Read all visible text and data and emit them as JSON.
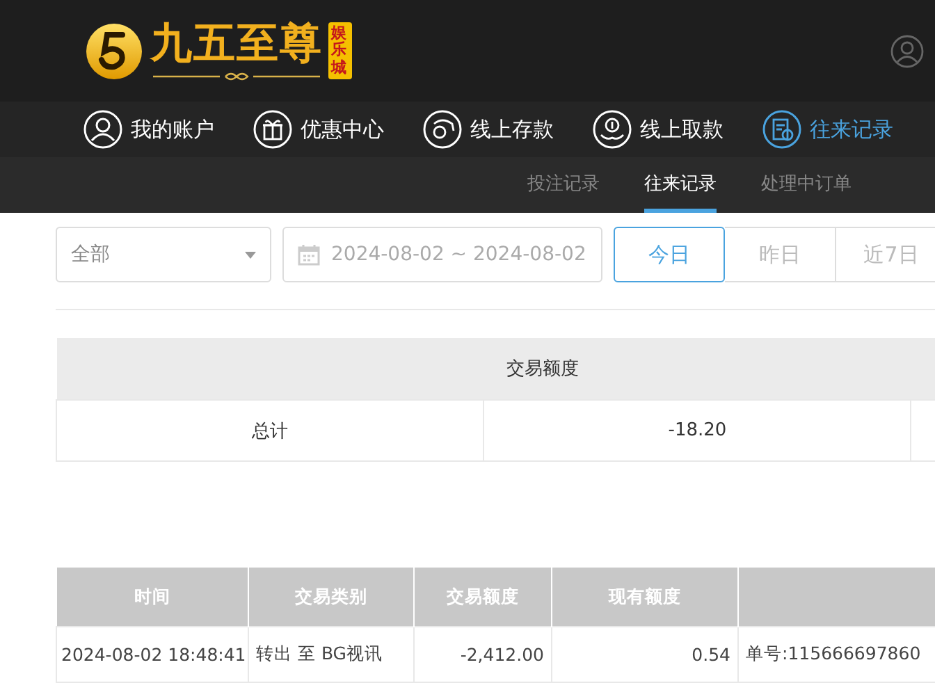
{
  "brand": {
    "name": "九五至尊",
    "badge": "娱乐城"
  },
  "nav": [
    {
      "label": "我的账户",
      "selected": false,
      "kind": "account"
    },
    {
      "label": "优惠中心",
      "selected": false,
      "kind": "promo"
    },
    {
      "label": "线上存款",
      "selected": false,
      "kind": "deposit"
    },
    {
      "label": "线上取款",
      "selected": false,
      "kind": "withdraw"
    },
    {
      "label": "往来记录",
      "selected": true,
      "kind": "record"
    }
  ],
  "subtabs": [
    {
      "label": "投注记录",
      "selected": false
    },
    {
      "label": "往来记录",
      "selected": true
    },
    {
      "label": "处理中订单",
      "selected": false
    }
  ],
  "filter": {
    "type_value": "全部",
    "date_range": "2024-08-02 ~ 2024-08-02",
    "quick": [
      {
        "label": "今日",
        "selected": true
      },
      {
        "label": "昨日",
        "selected": false
      },
      {
        "label": "近7日",
        "selected": false
      }
    ]
  },
  "summary": {
    "header": "交易额度",
    "label": "总计",
    "value": "-18.20"
  },
  "records": {
    "columns": [
      "时间",
      "交易类别",
      "交易额度",
      "现有额度"
    ],
    "rows": [
      [
        "2024-08-02 18:48:41",
        "转出 至 BG视讯",
        "-2,412.00",
        "0.54",
        "单号:115666697860"
      ]
    ]
  }
}
